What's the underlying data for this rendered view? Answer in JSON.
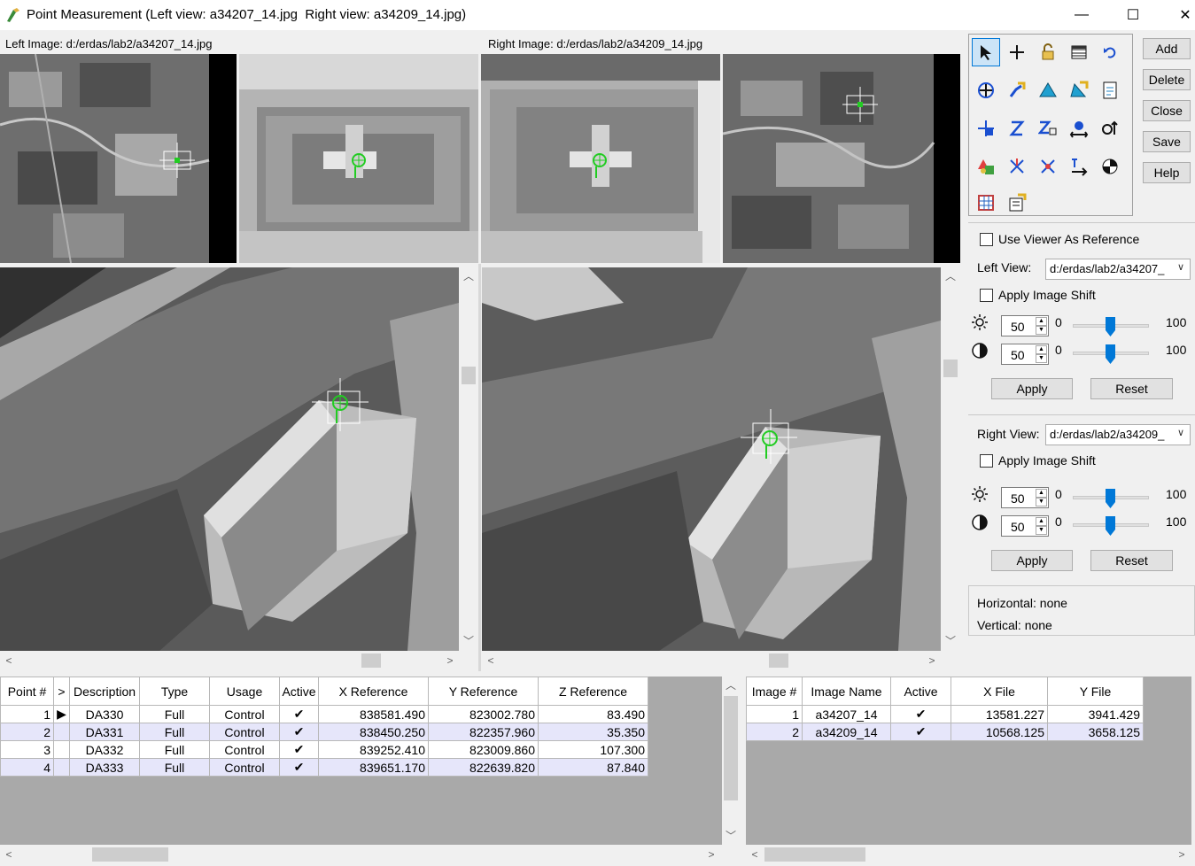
{
  "window": {
    "title": "Point Measurement (Left view: a34207_14.jpg  Right view: a34209_14.jpg)",
    "min": "—",
    "max": "☐",
    "close": "✕"
  },
  "left_image_label": "Left Image: d:/erdas/lab2/a34207_14.jpg",
  "right_image_label": "Right Image: d:/erdas/lab2/a34209_14.jpg",
  "tools_icons": [
    "select-arrow-icon",
    "crosshair-icon",
    "lock-icon",
    "table-icon",
    "undo-icon",
    "add-point-icon",
    "link-cursor-icon",
    "triangle-icon",
    "auto-link-icon",
    "report-icon",
    "add-point-image-icon",
    "z-icon",
    "z-box-icon",
    "transfer-icon",
    "drive-icon",
    "properties-icon",
    "delete-point-icon",
    "delete-all-icon",
    "measure-icon",
    "circle-quadrant-icon",
    "grid-icon",
    "settings-icon"
  ],
  "side_buttons": {
    "add": "Add",
    "delete": "Delete",
    "close": "Close",
    "save": "Save",
    "help": "Help"
  },
  "reference": {
    "use_viewer_label": "Use Viewer As Reference",
    "left_view_label": "Left View:",
    "left_view_value": "d:/erdas/lab2/a34207_",
    "right_view_label": "Right View:",
    "right_view_value": "d:/erdas/lab2/a34209_",
    "apply_shift_label": "Apply Image Shift",
    "left_brightness": "50",
    "left_contrast": "50",
    "right_brightness": "50",
    "right_contrast": "50",
    "min": "0",
    "max": "100",
    "apply": "Apply",
    "reset": "Reset"
  },
  "status": {
    "horizontal": "Horizontal: none",
    "vertical": "Vertical: none"
  },
  "points_table": {
    "headers": [
      "Point #",
      ">",
      "Description",
      "Type",
      "Usage",
      "Active",
      "X Reference",
      "Y Reference",
      "Z Reference"
    ],
    "rows": [
      {
        "n": "1",
        "mark": "▶",
        "desc": "DA330",
        "type": "Full",
        "usage": "Control",
        "active": "✔",
        "x": "838581.490",
        "y": "823002.780",
        "z": "83.490"
      },
      {
        "n": "2",
        "mark": "",
        "desc": "DA331",
        "type": "Full",
        "usage": "Control",
        "active": "✔",
        "x": "838450.250",
        "y": "822357.960",
        "z": "35.350"
      },
      {
        "n": "3",
        "mark": "",
        "desc": "DA332",
        "type": "Full",
        "usage": "Control",
        "active": "✔",
        "x": "839252.410",
        "y": "823009.860",
        "z": "107.300"
      },
      {
        "n": "4",
        "mark": "",
        "desc": "DA333",
        "type": "Full",
        "usage": "Control",
        "active": "✔",
        "x": "839651.170",
        "y": "822639.820",
        "z": "87.840"
      }
    ]
  },
  "images_table": {
    "headers": [
      "Image #",
      "Image Name",
      "Active",
      "X File",
      "Y File"
    ],
    "rows": [
      {
        "n": "1",
        "name": "a34207_14",
        "active": "✔",
        "x": "13581.227",
        "y": "3941.429"
      },
      {
        "n": "2",
        "name": "a34209_14",
        "active": "✔",
        "x": "10568.125",
        "y": "3658.125"
      }
    ]
  },
  "colors": {
    "marker": "#22cc22",
    "accent": "#0078d7"
  }
}
